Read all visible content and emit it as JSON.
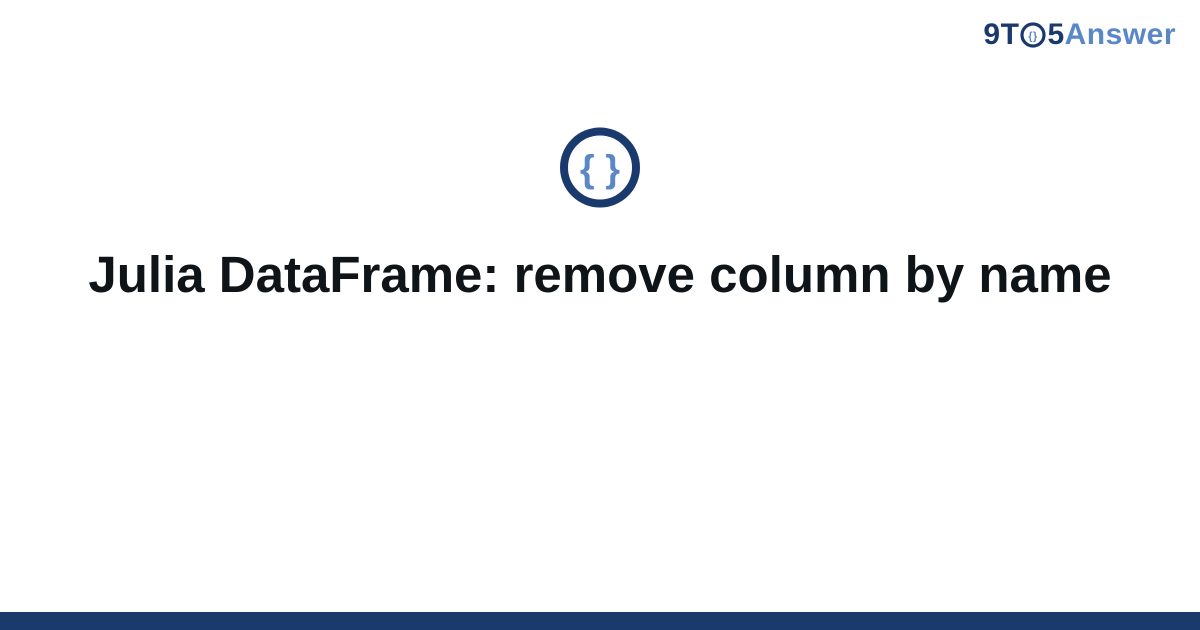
{
  "brand": {
    "part1": "9T",
    "part2": "5",
    "part3": "Answer"
  },
  "title": "Julia DataFrame: remove column by name",
  "colors": {
    "brand_dark": "#1a3a6e",
    "brand_light": "#5a88c6"
  }
}
